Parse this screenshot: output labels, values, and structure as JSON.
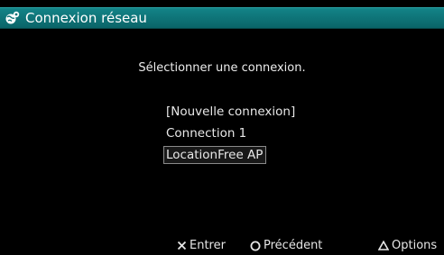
{
  "header": {
    "title": "Connexion réseau",
    "icon": "network-globe-icon",
    "color": "#0e7478"
  },
  "prompt": "Sélectionner une connexion.",
  "connections": [
    {
      "label": "[Nouvelle connexion]",
      "selected": false
    },
    {
      "label": "Connection 1",
      "selected": false
    },
    {
      "label": "LocationFree AP",
      "selected": true
    }
  ],
  "footer": {
    "enter_label": "Entrer",
    "back_label": "Précédent",
    "options_label": "Options",
    "enter_icon": "cross-button-icon",
    "back_icon": "circle-button-icon",
    "options_icon": "triangle-button-icon"
  }
}
